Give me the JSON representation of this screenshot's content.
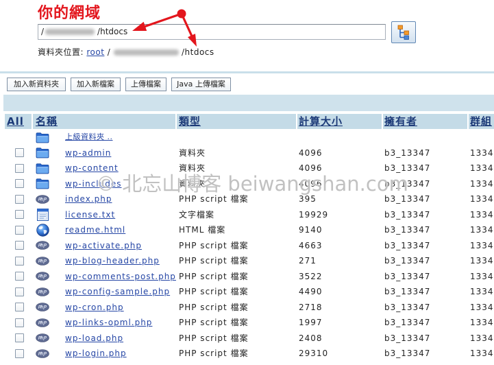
{
  "annotation": {
    "label": "你的網域"
  },
  "path_input": {
    "prefix": "/",
    "suffix": "/htdocs"
  },
  "location": {
    "label": "資料夾位置:",
    "root": "root",
    "separator": "/",
    "suffix": "/htdocs"
  },
  "toolbar": {
    "new_folder": "加入新資料夾",
    "new_file": "加入新檔案",
    "upload": "上傳檔案",
    "java_upload": "Java 上傳檔案"
  },
  "table": {
    "headers": {
      "all": "All",
      "name": "名稱",
      "type": "類型",
      "size": "計算大小",
      "owner": "擁有者",
      "group": "群組"
    },
    "parent": {
      "icon": "folder-icon",
      "label": "上級資料夾 .."
    },
    "rows": [
      {
        "icon": "folder-icon",
        "name": "wp-admin",
        "type": "資料夾",
        "size": 4096,
        "owner": "b3_13347",
        "group": "1334"
      },
      {
        "icon": "folder-icon",
        "name": "wp-content",
        "type": "資料夾",
        "size": 4096,
        "owner": "b3_13347",
        "group": "1334"
      },
      {
        "icon": "folder-icon",
        "name": "wp-includes",
        "type": "資料夾",
        "size": 4096,
        "owner": "b3_13347",
        "group": "1334"
      },
      {
        "icon": "php-icon",
        "name": "index.php",
        "type": "PHP script 檔案",
        "size": 395,
        "owner": "b3_13347",
        "group": "1334"
      },
      {
        "icon": "text-file-icon",
        "name": "license.txt",
        "type": "文字檔案",
        "size": 19929,
        "owner": "b3_13347",
        "group": "1334"
      },
      {
        "icon": "globe-icon",
        "name": "readme.html",
        "type": "HTML 檔案",
        "size": 9140,
        "owner": "b3_13347",
        "group": "1334"
      },
      {
        "icon": "php-icon",
        "name": "wp-activate.php",
        "type": "PHP script 檔案",
        "size": 4663,
        "owner": "b3_13347",
        "group": "1334"
      },
      {
        "icon": "php-icon",
        "name": "wp-blog-header.php",
        "type": "PHP script 檔案",
        "size": 271,
        "owner": "b3_13347",
        "group": "1334"
      },
      {
        "icon": "php-icon",
        "name": "wp-comments-post.php",
        "type": "PHP script 檔案",
        "size": 3522,
        "owner": "b3_13347",
        "group": "1334"
      },
      {
        "icon": "php-icon",
        "name": "wp-config-sample.php",
        "type": "PHP script 檔案",
        "size": 4490,
        "owner": "b3_13347",
        "group": "1334"
      },
      {
        "icon": "php-icon",
        "name": "wp-cron.php",
        "type": "PHP script 檔案",
        "size": 2718,
        "owner": "b3_13347",
        "group": "1334"
      },
      {
        "icon": "php-icon",
        "name": "wp-links-opml.php",
        "type": "PHP script 檔案",
        "size": 1997,
        "owner": "b3_13347",
        "group": "1334"
      },
      {
        "icon": "php-icon",
        "name": "wp-load.php",
        "type": "PHP script 檔案",
        "size": 2408,
        "owner": "b3_13347",
        "group": "1334"
      },
      {
        "icon": "php-icon",
        "name": "wp-login.php",
        "type": "PHP script 檔案",
        "size": 29310,
        "owner": "b3_13347",
        "group": "1334"
      }
    ]
  },
  "watermark": "© 北忘山博客 beiwangshan.com",
  "colors": {
    "annotation": "#e3161d",
    "link": "#2546a5",
    "header_text": "#1c3a78",
    "header_bg": "#c4dbe7",
    "band_bg": "#cfe2ec"
  }
}
